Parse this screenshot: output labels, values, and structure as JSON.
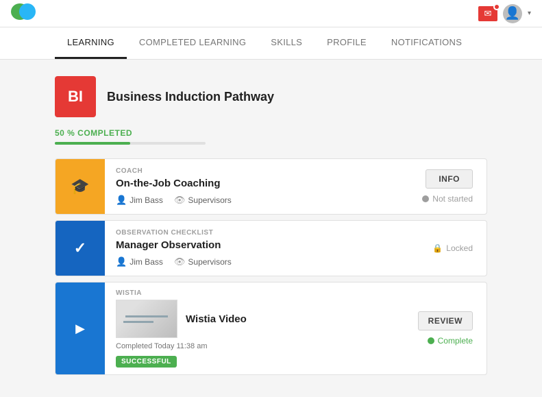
{
  "header": {
    "logo_alt": "App Logo"
  },
  "nav": {
    "tabs": [
      {
        "id": "learning",
        "label": "LEARNING",
        "active": true
      },
      {
        "id": "completed-learning",
        "label": "COMPLETED LEARNING",
        "active": false
      },
      {
        "id": "skills",
        "label": "SKILLS",
        "active": false
      },
      {
        "id": "profile",
        "label": "PROFILE",
        "active": false
      },
      {
        "id": "notifications",
        "label": "NOTIFICATIONS",
        "active": false
      }
    ]
  },
  "pathway": {
    "icon_text": "BI",
    "title": "Business Induction Pathway",
    "progress_label": "50 % COMPLETED",
    "progress_percent": 50
  },
  "courses": [
    {
      "id": "coaching",
      "icon_color": "orange",
      "icon_symbol": "🎓",
      "type_label": "COACH",
      "title": "On-the-Job Coaching",
      "assigned_by": "Jim Bass",
      "audience": "Supervisors",
      "action_label": "INFO",
      "status": "Not started",
      "status_type": "not-started"
    },
    {
      "id": "observation",
      "icon_color": "blue",
      "icon_symbol": "✓",
      "type_label": "OBSERVATION CHECKLIST",
      "title": "Manager Observation",
      "assigned_by": "Jim Bass",
      "audience": "Supervisors",
      "action_label": null,
      "status": "Locked",
      "status_type": "locked"
    },
    {
      "id": "wistia-video",
      "icon_color": "blue-light",
      "icon_symbol": "▶",
      "type_label": "WISTIA",
      "title": "Wistia Video",
      "completed_text": "Completed Today 11:38 am",
      "badge_label": "SUCCESSFUL",
      "action_label": "REVIEW",
      "status": "Complete",
      "status_type": "complete"
    }
  ]
}
